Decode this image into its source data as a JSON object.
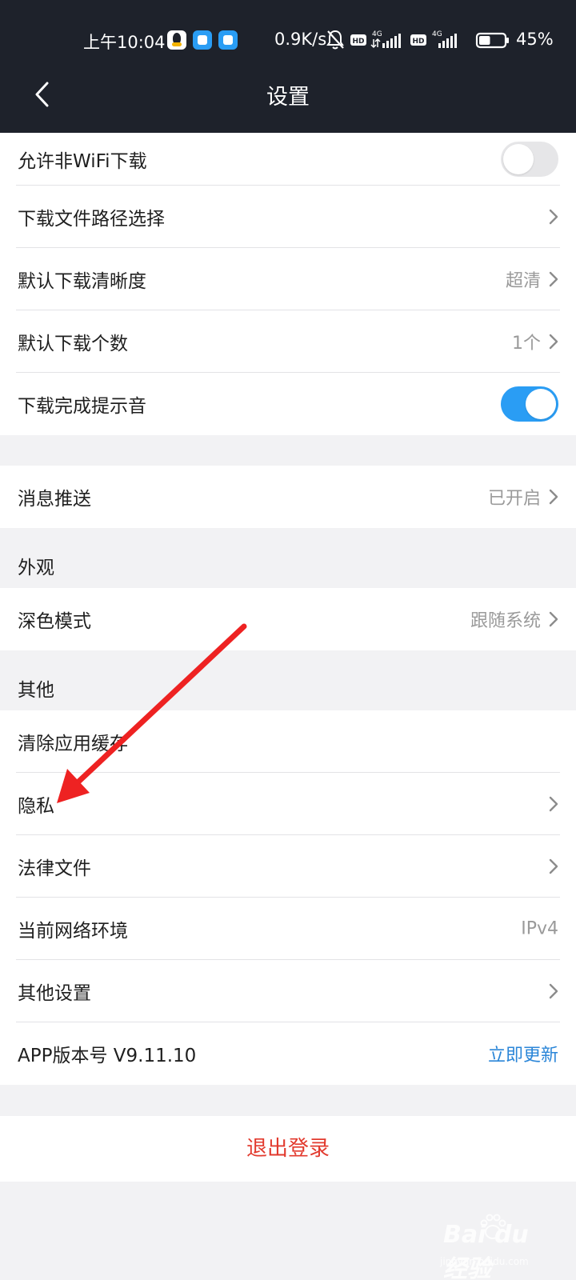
{
  "status_bar": {
    "time": "上午10:04",
    "net_speed": "0.9K/s",
    "battery_percent": "45%",
    "battery_level": 0.45,
    "icons": [
      "qq-icon",
      "app-icon",
      "app-icon",
      "bell-muted-icon",
      "hd-icon",
      "signal-4g-icon",
      "hd-icon",
      "signal-4g-icon",
      "battery-icon"
    ],
    "network_label": "4G"
  },
  "header": {
    "title": "设置",
    "back_icon": "chevron-left-icon"
  },
  "download_settings": {
    "wifi_download": {
      "label": "允许非WiFi下载",
      "enabled": false
    },
    "path_select": {
      "label": "下载文件路径选择"
    },
    "default_quality": {
      "label": "默认下载清晰度",
      "value": "超清"
    },
    "default_count": {
      "label": "默认下载个数",
      "value": "1个"
    },
    "completion_sound": {
      "label": "下载完成提示音",
      "enabled": true
    }
  },
  "notifications": {
    "push": {
      "label": "消息推送",
      "value": "已开启"
    }
  },
  "appearance": {
    "section_title": "外观",
    "dark_mode": {
      "label": "深色模式",
      "value": "跟随系统"
    }
  },
  "other": {
    "section_title": "其他",
    "clear_cache": {
      "label": "清除应用缓存"
    },
    "privacy": {
      "label": "隐私"
    },
    "legal": {
      "label": "法律文件"
    },
    "network_env": {
      "label": "当前网络环境",
      "value": "IPv4"
    },
    "other_settings": {
      "label": "其他设置"
    },
    "app_version": {
      "label": "APP版本号 V9.11.10",
      "action": "立即更新"
    }
  },
  "logout": {
    "label": "退出登录"
  },
  "watermark": {
    "brand": "Bai du 经验",
    "sub": "jingyan.baidu.com"
  },
  "colors": {
    "topbar": "#1e222b",
    "accent_blue": "#2a9df4",
    "link_blue": "#2b86d8",
    "logout_red": "#e23a2e",
    "annotation_red": "#ee2222"
  }
}
